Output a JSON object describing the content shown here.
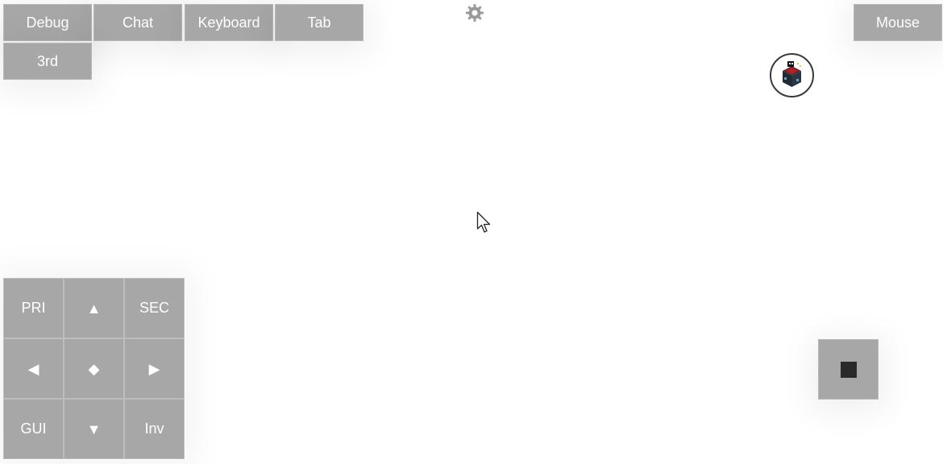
{
  "top_bar": {
    "debug_label": "Debug",
    "chat_label": "Chat",
    "keyboard_label": "Keyboard",
    "tab_label": "Tab",
    "third_person_label": "3rd",
    "mouse_label": "Mouse"
  },
  "icons": {
    "settings": "gear-icon",
    "avatar": "avatar-icon",
    "cursor": "mouse-pointer-icon",
    "stop": "stop-square-icon"
  },
  "dpad": {
    "primary_label": "PRI",
    "up_glyph": "▲",
    "secondary_label": "SEC",
    "left_glyph": "◀",
    "center_glyph": "◆",
    "right_glyph": "▶",
    "gui_label": "GUI",
    "down_glyph": "▼",
    "inventory_label": "Inv"
  },
  "colors": {
    "button_bg": "#a7a7a7",
    "button_text": "#ffffff",
    "background": "#ffffff"
  }
}
